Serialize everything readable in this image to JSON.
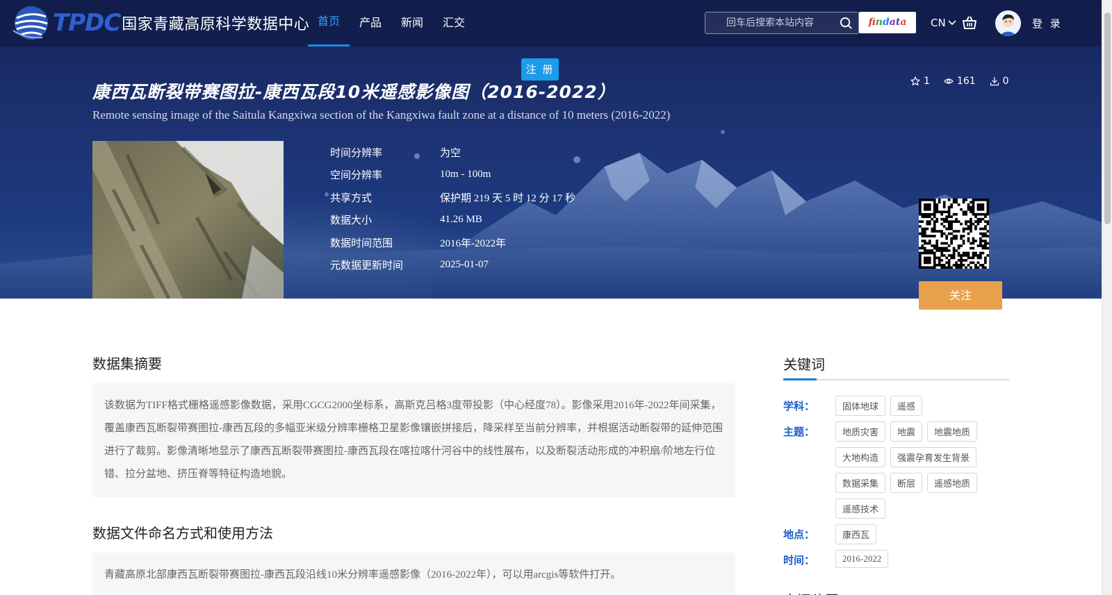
{
  "nav": {
    "logo_tpdc": "TPDC",
    "logo_cn": "国家青藏高原科学数据中心",
    "menu": [
      "首页",
      "产品",
      "新闻",
      "汇交"
    ],
    "search_placeholder": "回车后搜索本站内容",
    "findata": "findata",
    "lang": "CN",
    "login": "登 录"
  },
  "hero": {
    "register": "注 册",
    "title_cn": "康西瓦断裂带赛图拉-康西瓦段10米遥感影像图（2016-2022）",
    "title_en": "Remote sensing image of the Saitula Kangxiwa section of the Kangxiwa fault zone at a distance of 10 meters (2016-2022)",
    "stats": {
      "stars": "1",
      "views": "161",
      "downloads": "0"
    },
    "meta": [
      {
        "key": "时间分辨率",
        "value": "为空"
      },
      {
        "key": "空间分辨率",
        "value": "10m - 100m"
      },
      {
        "key": "共享方式",
        "value": "保护期 219 天 5 时 12 分 17 秒"
      },
      {
        "key": "数据大小",
        "value": "41.26 MB"
      },
      {
        "key": "数据时间范围",
        "value": "2016年-2022年"
      },
      {
        "key": "元数据更新时间",
        "value": "2025-01-07"
      }
    ],
    "follow": "关注"
  },
  "abstract": {
    "title": "数据集摘要",
    "text": "该数据为TIFF格式栅格遥感影像数据，采用CGCG2000坐标系，高斯克吕格3度带投影（中心经度78）。影像采用2016年-2022年间采集，覆盖康西瓦断裂带赛图拉-康西瓦段的多幅亚米级分辨率栅格卫星影像镶嵌拼接后，降采样至当前分辨率，并根据活动断裂带的延伸范围进行了裁剪。影像清晰地显示了康西瓦断裂带赛图拉-康西瓦段在喀拉喀什河谷中的线性展布，以及断裂活动形成的冲积扇/阶地左行位错、拉分盆地、挤压脊等特征构造地貌。"
  },
  "naming": {
    "title": "数据文件命名方式和使用方法",
    "text": "青藏高原北部康西瓦断裂带赛图拉-康西瓦段沿线10米分辨率遥感影像（2016-2022年），可以用arcgis等软件打开。"
  },
  "keywords": {
    "title": "关键词",
    "rows": [
      {
        "label": "学科：",
        "tags": [
          "固体地球",
          "遥感"
        ]
      },
      {
        "label": "主题：",
        "tags": [
          "地质灾害",
          "地震",
          "地震地质",
          "大地构造",
          "强震孕育发生背景",
          "数据采集",
          "断层",
          "遥感地质",
          "遥感技术"
        ]
      },
      {
        "label": "地点：",
        "tags": [
          "康西瓦"
        ]
      },
      {
        "label": "时间：",
        "tags": [
          "2016-2022"
        ]
      }
    ]
  },
  "next_section_title": "空间位置",
  "colors": {
    "accent": "#1b9be8",
    "follow": "#e8a14a",
    "hero": "#1d3373",
    "keyword_label": "#1b5fc4"
  }
}
